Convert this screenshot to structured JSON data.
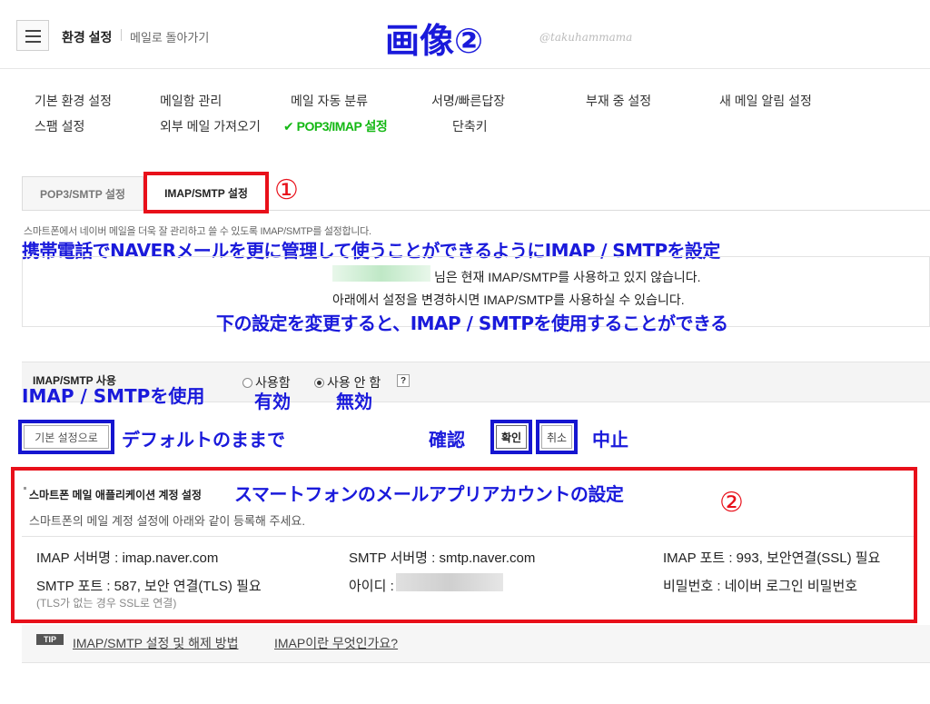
{
  "header": {
    "title": "환경 설정",
    "back_link": "메일로 돌아가기",
    "overlay_title": "画像②",
    "watermark": "@takuhammama"
  },
  "nav": {
    "items": [
      "기본 환경 설정",
      "메일함 관리",
      "메일 자동 분류",
      "서명/빠른답장",
      "부재 중 설정",
      "새 메일 알림 설정",
      "스팸 설정",
      "외부 메일 가져오기",
      "POP3/IMAP 설정",
      "단축키"
    ],
    "active_check": "✔"
  },
  "tabs": {
    "pop3": "POP3/SMTP 설정",
    "imap": "IMAP/SMTP 설정",
    "marker": "①"
  },
  "intro": {
    "description": "스마트폰에서 네이버 메일을 더욱 잘 관리하고 쓸 수 있도록 IMAP/SMTP를 설정합니다.",
    "annotation": "携帯電話でNAVERメールを更に管理して使うことができるようにIMAP / SMTPを設定",
    "status_line1": "님은 현재 IMAP/SMTP를 사용하고 있지 않습니다.",
    "status_line2": "아래에서 설정을 변경하시면 IMAP/SMTP를 사용하실 수 있습니다.",
    "status_annotation": "下の設定を変更すると、IMAP / SMTPを使用することができる"
  },
  "usage": {
    "label": "IMAP/SMTP 사용",
    "label_annotation": "IMAP / SMTPを使用",
    "option_use": "사용함",
    "option_nouse": "사용 안 함",
    "help": "?",
    "selected": "사용 안 함",
    "use_annotation": "有効",
    "nouse_annotation": "無効"
  },
  "buttons": {
    "default": "기본 설정으로",
    "default_annotation": "デフォルトのままで",
    "confirm_annotation": "確認",
    "confirm": "확인",
    "cancel": "취소",
    "cancel_annotation": "中止"
  },
  "account": {
    "title": "스마트폰 메일 애플리케이션 계정 설정",
    "title_annotation": "スマートフォンのメールアプリアカウントの設定",
    "marker": "②",
    "subtitle": "스마트폰의 메일 계정 설정에 아래와 같이 등록해 주세요.",
    "imap_server": "IMAP 서버명 : imap.naver.com",
    "smtp_server": "SMTP 서버명 : smtp.naver.com",
    "imap_port": "IMAP 포트 : 993, 보안연결(SSL) 필요",
    "smtp_port": "SMTP 포트 : 587, 보안 연결(TLS) 필요",
    "smtp_note": "(TLS가 없는 경우 SSL로 연결)",
    "id_label": "아이디 :",
    "password": "비밀번호 : 네이버 로그인 비밀번호"
  },
  "tips": {
    "badge": "TIP",
    "link1": "IMAP/SMTP 설정 및 해제 방법",
    "link2": "IMAP이란 무엇인가요?"
  },
  "colors": {
    "annotation_blue": "#1a1adb",
    "annotation_red": "#e8101a",
    "active_green": "#14b814"
  }
}
